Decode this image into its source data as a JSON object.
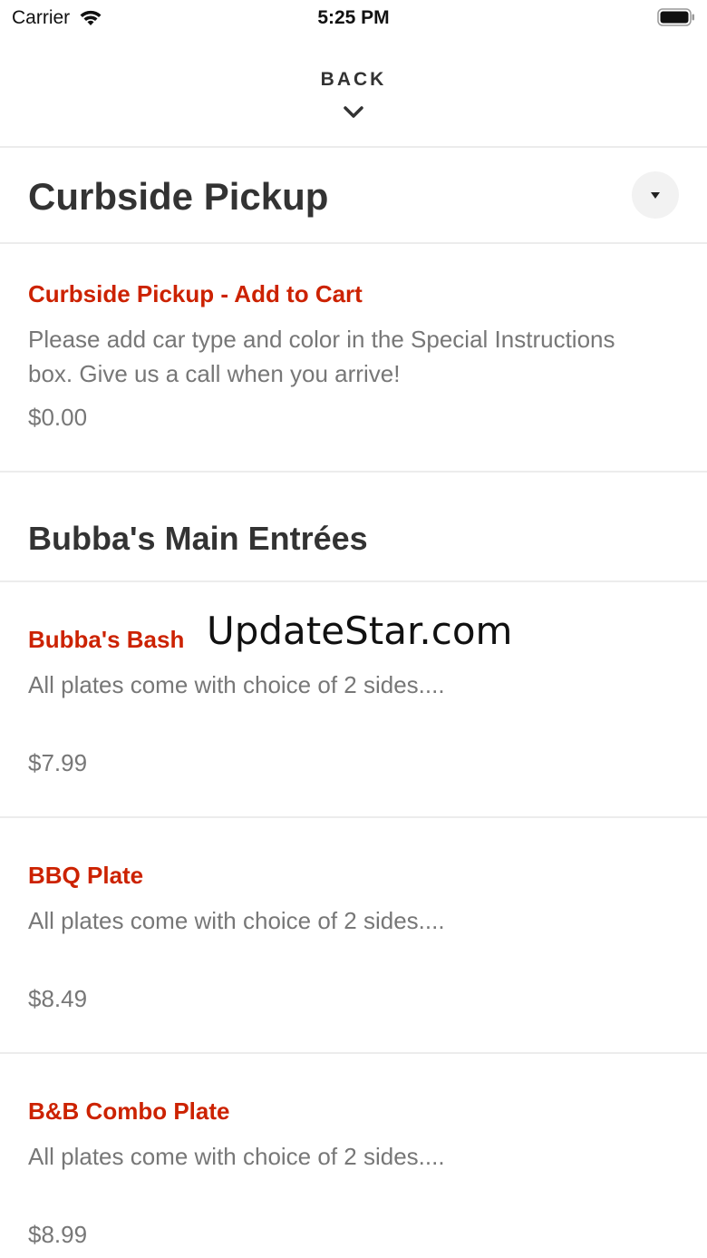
{
  "status_bar": {
    "carrier": "Carrier",
    "time": "5:25 PM"
  },
  "header": {
    "back_label": "BACK"
  },
  "sections": {
    "curbside": {
      "title": "Curbside Pickup",
      "item": {
        "name": "Curbside Pickup - Add to Cart",
        "description": "Please add car type and color in the Special Instructions box. Give us a call when you arrive!",
        "price": "$0.00"
      }
    },
    "entrees": {
      "title": "Bubba's Main Entrées",
      "items": [
        {
          "name": "Bubba's Bash",
          "description": "All plates come with choice of 2 sides....",
          "price": "$7.99"
        },
        {
          "name": "BBQ Plate",
          "description": "All plates come with choice of 2 sides....",
          "price": "$8.49"
        },
        {
          "name": "B&B Combo Plate",
          "description": "All plates come with choice of 2 sides....",
          "price": "$8.99"
        }
      ]
    }
  },
  "watermark": "UpdateStar.com",
  "colors": {
    "accent": "#cc2200",
    "text": "#333333",
    "muted": "#777777",
    "divider": "#ececec"
  },
  "icons": {
    "wifi": "wifi-icon",
    "battery": "battery-icon",
    "back": "chevron-down-icon",
    "collapse": "caret-down-icon"
  }
}
